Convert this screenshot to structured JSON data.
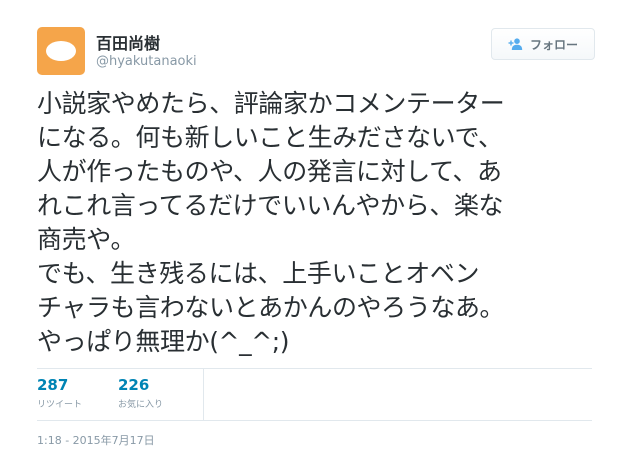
{
  "author": {
    "name": "百田尚樹",
    "handle": "@hyakutanaoki",
    "avatar_color": "#f5a54a"
  },
  "follow_button": {
    "label": "フォロー",
    "icon": "add-user-icon"
  },
  "tweet": {
    "lines": [
      "小説家やめたら、評論家かコメンテーター",
      "になる。何も新しいこと生みださないで、",
      "人が作ったものや、人の発言に対して、あ",
      "れこれ言ってるだけでいいんやから、楽な",
      "商売や。",
      "でも、生き残るには、上手いことオベン",
      "チャラも言わないとあかんのやろうなあ。",
      "やっぱり無理か(^_^;)"
    ]
  },
  "stats": {
    "retweets": {
      "value": "287",
      "label": "リツイート"
    },
    "favorites": {
      "value": "226",
      "label": "お気に入り"
    }
  },
  "timestamp": "1:18 - 2015年7月17日",
  "colors": {
    "link": "#0084b4",
    "muted": "#8899a6",
    "text": "#292f33",
    "border": "#e1e8ed"
  }
}
